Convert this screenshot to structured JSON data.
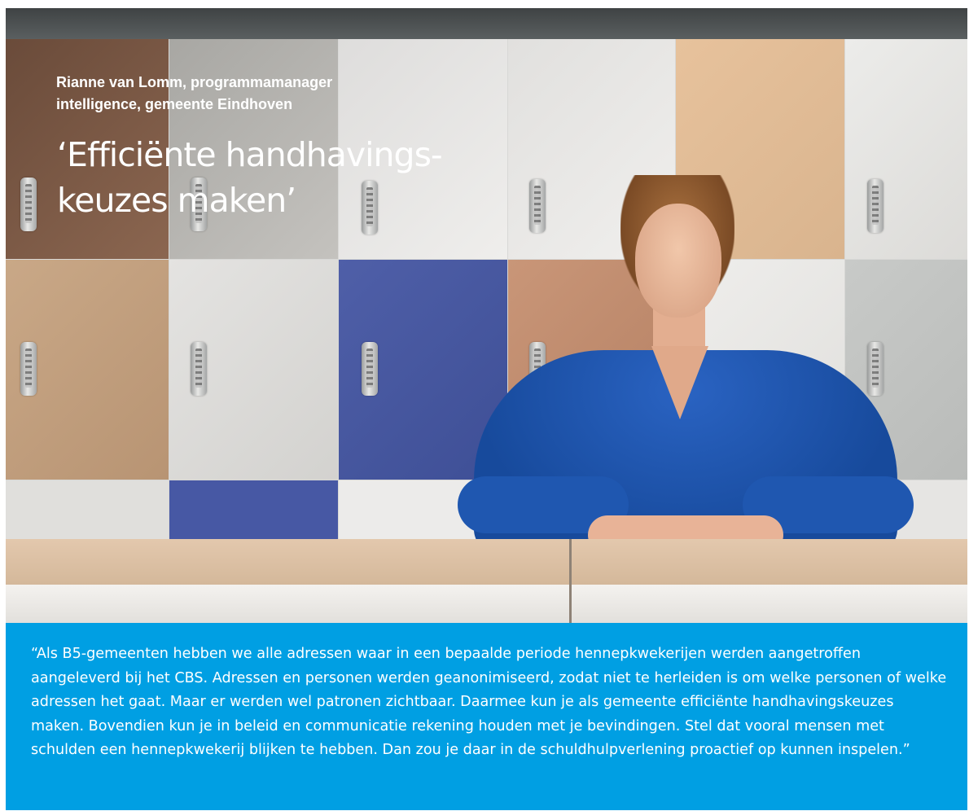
{
  "article": {
    "byline": "Rianne van Lomm, programmamanager intelligence, gemeente Eindhoven",
    "headline": "‘Efficiënte handhavings-\n keuzes maken’",
    "quote": "“Als B5-gemeenten hebben we alle adressen waar in een bepaalde periode hennepkwekerijen werden aangetroffen aangeleverd bij het CBS. Adressen en personen werden geanonimiseerd, zodat niet te herleiden is om welke personen of welke adressen het gaat. Maar er werden wel patronen zichtbaar. Daarmee kun je als gemeente efficiënte handhavingskeuzes maken. Bovendien kun je in beleid en communicatie rekening houden met je bevindingen. Stel dat vooral mensen met schulden een hennepkwekerij blijken te hebben. Dan zou je daar in de schuldhulpverlening proactief op kunnen inspelen.”"
  },
  "colors": {
    "quote_background": "#009fe3",
    "text": "#ffffff",
    "shirt": "#1f57b0"
  }
}
